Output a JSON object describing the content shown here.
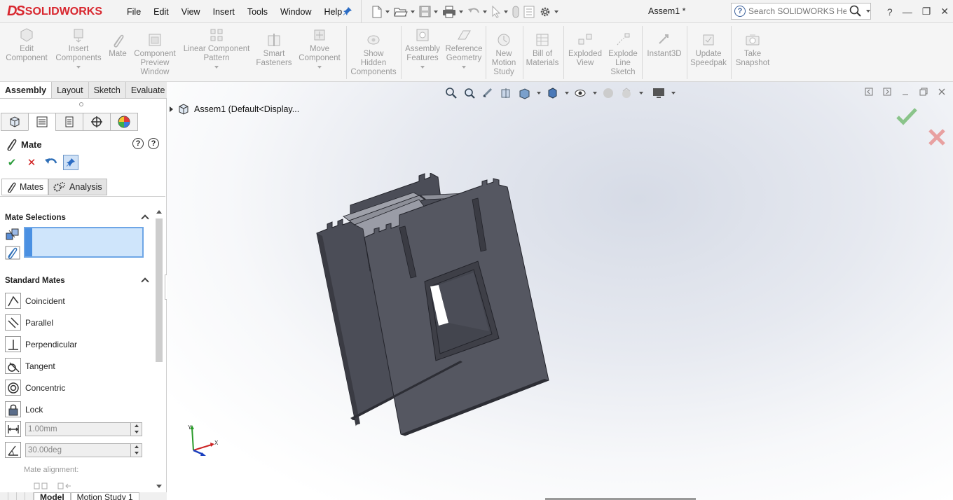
{
  "app": {
    "logo_prefix": "DS",
    "logo_name": "SOLIDWORKS",
    "document_title": "Assem1 *",
    "help_search_placeholder": "Search SOLIDWORKS Help",
    "help_question": "?",
    "win_min": "—",
    "win_restore": "❐",
    "win_close": "✕"
  },
  "menu": [
    "File",
    "Edit",
    "View",
    "Insert",
    "Tools",
    "Window",
    "Help"
  ],
  "ribbon": {
    "edit_component": [
      "Edit",
      "Component"
    ],
    "insert_components": [
      "Insert",
      "Components"
    ],
    "mate": [
      "Mate"
    ],
    "component_preview": [
      "Component",
      "Preview",
      "Window"
    ],
    "linear_pattern": [
      "Linear Component",
      "Pattern"
    ],
    "smart_fasteners": [
      "Smart",
      "Fasteners"
    ],
    "move_component": [
      "Move",
      "Component"
    ],
    "show_hidden": [
      "Show",
      "Hidden",
      "Components"
    ],
    "assembly_features": [
      "Assembly",
      "Features"
    ],
    "reference_geometry": [
      "Reference",
      "Geometry"
    ],
    "new_motion_study": [
      "New",
      "Motion",
      "Study"
    ],
    "bill_of_materials": [
      "Bill of",
      "Materials"
    ],
    "exploded_view": [
      "Exploded",
      "View"
    ],
    "explode_line_sketch": [
      "Explode",
      "Line",
      "Sketch"
    ],
    "instant3d": [
      "Instant3D"
    ],
    "update_speedpak": [
      "Update",
      "Speedpak"
    ],
    "take_snapshot": [
      "Take",
      "Snapshot"
    ]
  },
  "command_tabs": [
    "Assembly",
    "Layout",
    "Sketch",
    "Evaluate"
  ],
  "property_manager": {
    "title": "Mate",
    "subtab_mates": "Mates",
    "subtab_analysis": "Analysis",
    "section_selections": "Mate Selections",
    "section_standard": "Standard Mates",
    "mates": [
      "Coincident",
      "Parallel",
      "Perpendicular",
      "Tangent",
      "Concentric",
      "Lock"
    ],
    "distance_value": "1.00mm",
    "angle_value": "30.00deg",
    "mate_alignment_label": "Mate alignment:"
  },
  "bottom_tabs": [
    "Model",
    "Motion Study 1"
  ],
  "tree": {
    "root_label": "Assem1  (Default<Display..."
  },
  "triad": {
    "x": "X",
    "y": "Y"
  },
  "colors": {
    "brand_red": "#d8262e",
    "model_face": "#4c4e58",
    "model_edge": "#2b2c33",
    "confirm_green": "#8ac48a",
    "cancel_red": "#e8a0a0",
    "selection_blue": "#cfe5fb"
  }
}
